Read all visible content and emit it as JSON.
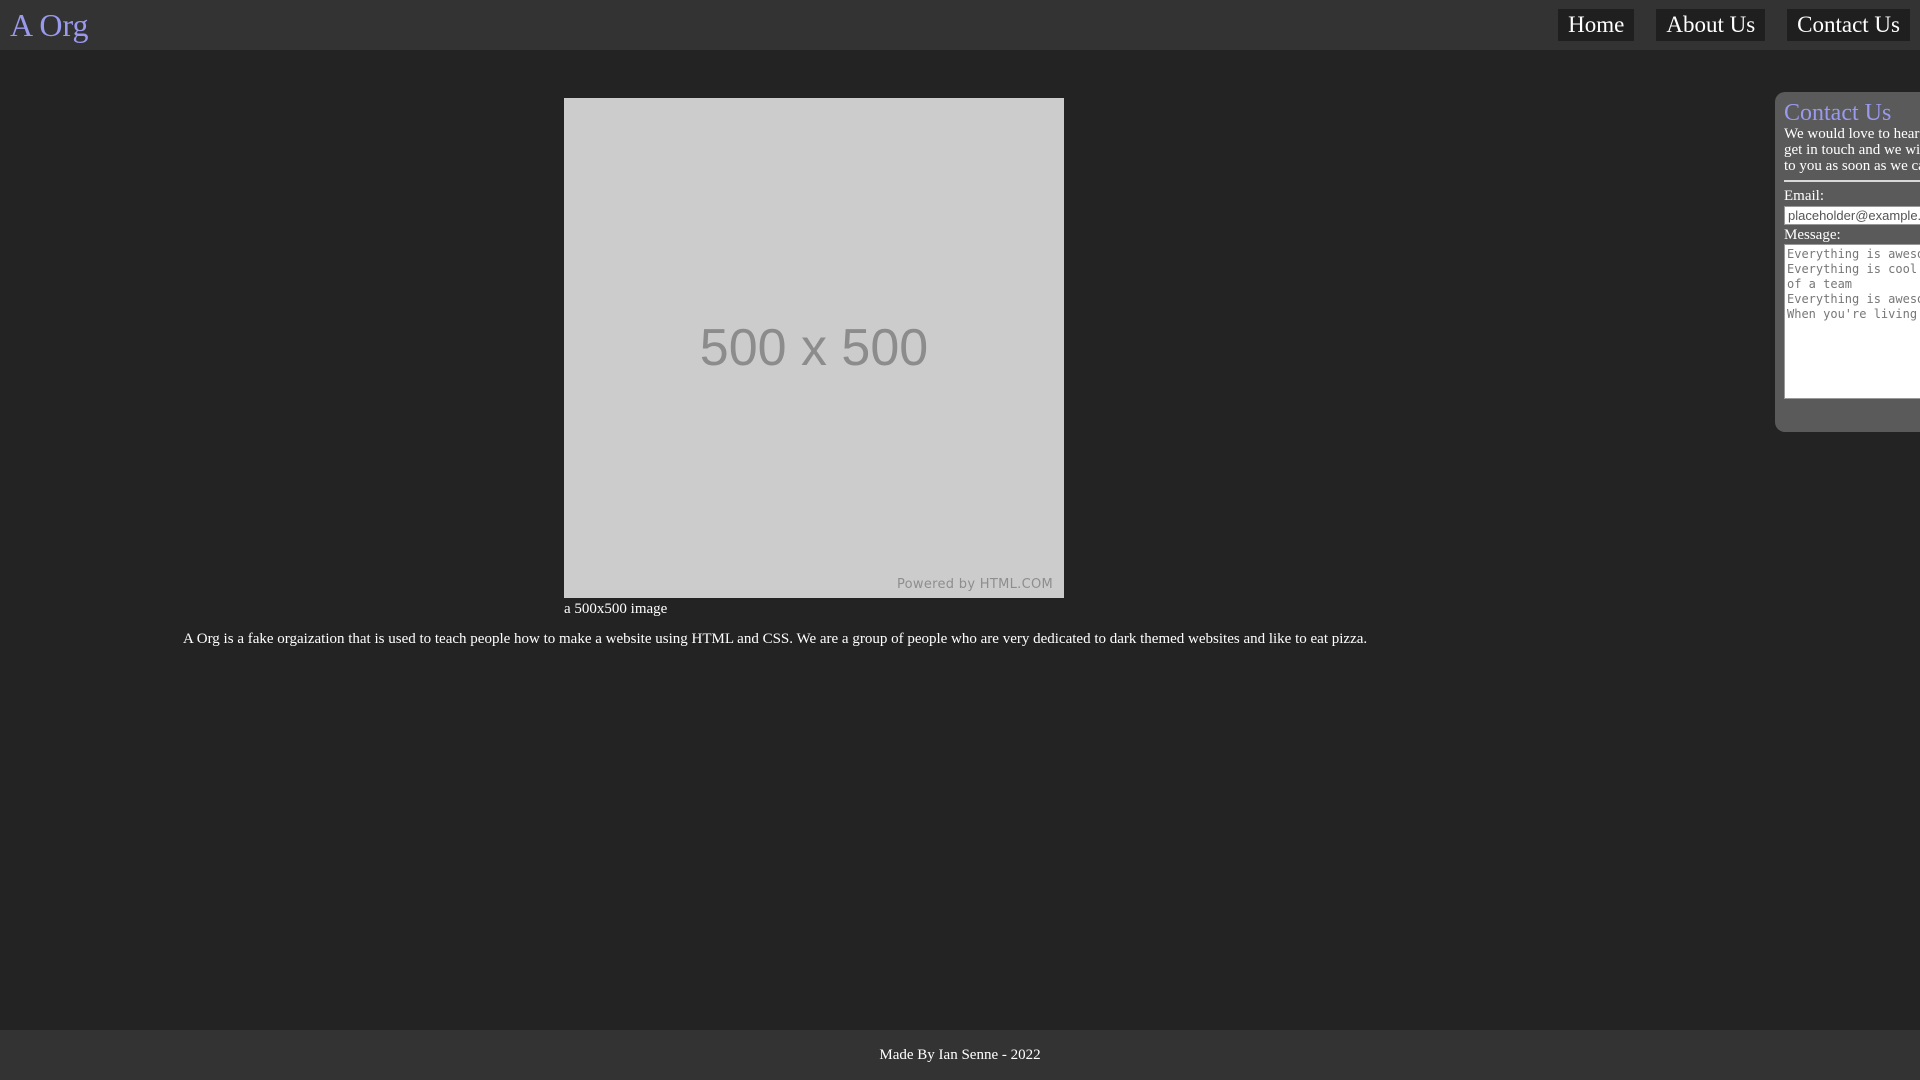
{
  "header": {
    "logo": "A Org",
    "nav": [
      {
        "label": "Home"
      },
      {
        "label": "About Us"
      },
      {
        "label": "Contact Us"
      }
    ]
  },
  "main": {
    "image": {
      "text": "500 x 500",
      "powered_by": "Powered by HTML.COM",
      "caption": "a 500x500 image"
    },
    "about_text": "A Org is a fake orgaization that is used to teach people how to make a website using HTML and CSS. We are a group of people who are very dedicated to dark themed websites and like to eat pizza."
  },
  "contact": {
    "title": "Contact Us",
    "description": "We would love to hear from you, get in touch and we will get back to you as soon as we can",
    "email_label": "Email:",
    "email_placeholder": "placeholder@example.com",
    "message_label": "Message:",
    "message_placeholder": "Everything is awesome\nEverything is cool when you're part\nof a team\nEverything is awesome\nWhen you're living our dream"
  },
  "footer": {
    "credit": "Made By Ian Senne - 2022"
  },
  "colors": {
    "background": "#232323",
    "bars": "#333333",
    "accent": "#9999ee",
    "panel": "#5a5a5a"
  }
}
